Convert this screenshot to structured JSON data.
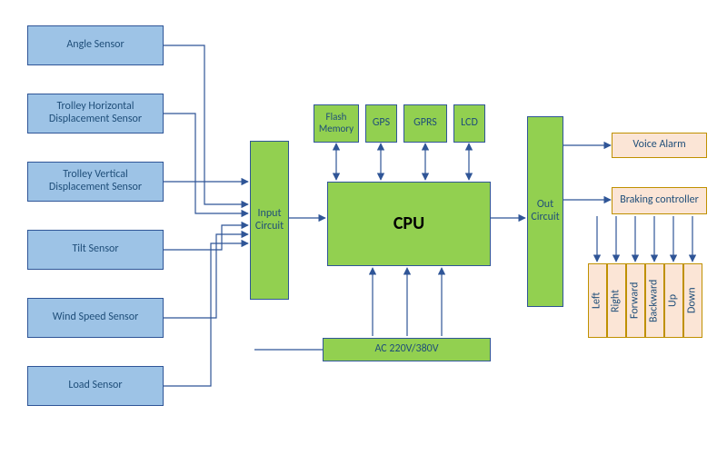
{
  "sensors": {
    "angle": "Angle Sensor",
    "horiz": "Trolley  Horizontal Displacement Sensor",
    "vert": "Trolley  Vertical Displacement Sensor",
    "tilt": "Tilt Sensor",
    "wind": "Wind Speed Sensor",
    "load": "Load Sensor"
  },
  "blocks": {
    "input_circuit": "Input Circuit",
    "flash": "Flash Memory",
    "gps": "GPS",
    "gprs": "GPRS",
    "lcd": "LCD",
    "cpu": "CPU",
    "power": "AC 220V/380V",
    "out_circuit": "Out Circuit",
    "voice_alarm": "Voice Alarm",
    "braking": "Braking controller"
  },
  "directions": {
    "left": "Left",
    "right": "Right",
    "forward": "Forward",
    "backward": "Backward",
    "up": "Up",
    "down": "Down"
  }
}
